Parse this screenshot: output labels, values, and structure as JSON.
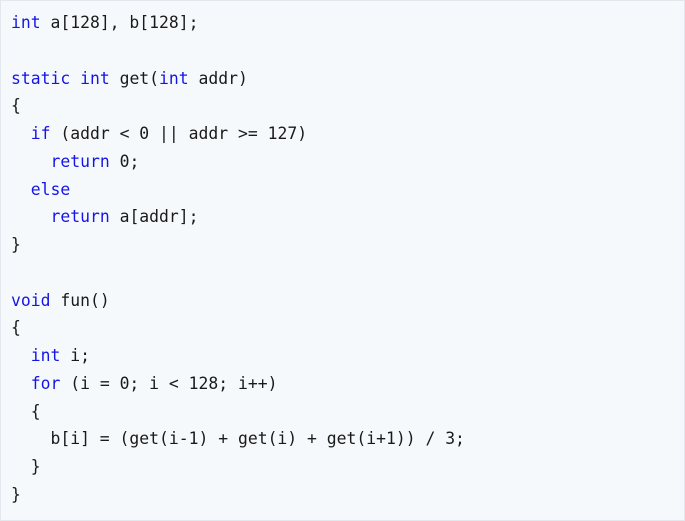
{
  "code": {
    "language": "c",
    "keyword_color": "#1515e6",
    "text_color": "#1a1a1a",
    "lines": [
      [
        {
          "t": "int",
          "k": true
        },
        {
          "t": " a[128], b[128];"
        }
      ],
      [],
      [
        {
          "t": "static",
          "k": true
        },
        {
          "t": " "
        },
        {
          "t": "int",
          "k": true
        },
        {
          "t": " get("
        },
        {
          "t": "int",
          "k": true
        },
        {
          "t": " addr)"
        }
      ],
      [
        {
          "t": "{"
        }
      ],
      [
        {
          "t": "  "
        },
        {
          "t": "if",
          "k": true
        },
        {
          "t": " (addr < 0 || addr >= 127)"
        }
      ],
      [
        {
          "t": "    "
        },
        {
          "t": "return",
          "k": true
        },
        {
          "t": " 0;"
        }
      ],
      [
        {
          "t": "  "
        },
        {
          "t": "else",
          "k": true
        }
      ],
      [
        {
          "t": "    "
        },
        {
          "t": "return",
          "k": true
        },
        {
          "t": " a[addr];"
        }
      ],
      [
        {
          "t": "}"
        }
      ],
      [],
      [
        {
          "t": "void",
          "k": true
        },
        {
          "t": " fun()"
        }
      ],
      [
        {
          "t": "{"
        }
      ],
      [
        {
          "t": "  "
        },
        {
          "t": "int",
          "k": true
        },
        {
          "t": " i;"
        }
      ],
      [
        {
          "t": "  "
        },
        {
          "t": "for",
          "k": true
        },
        {
          "t": " (i = 0; i < 128; i++)"
        }
      ],
      [
        {
          "t": "  {"
        }
      ],
      [
        {
          "t": "    b[i] = (get(i-1) + get(i) + get(i+1)) / 3;"
        }
      ],
      [
        {
          "t": "  }"
        }
      ],
      [
        {
          "t": "}"
        }
      ]
    ]
  }
}
